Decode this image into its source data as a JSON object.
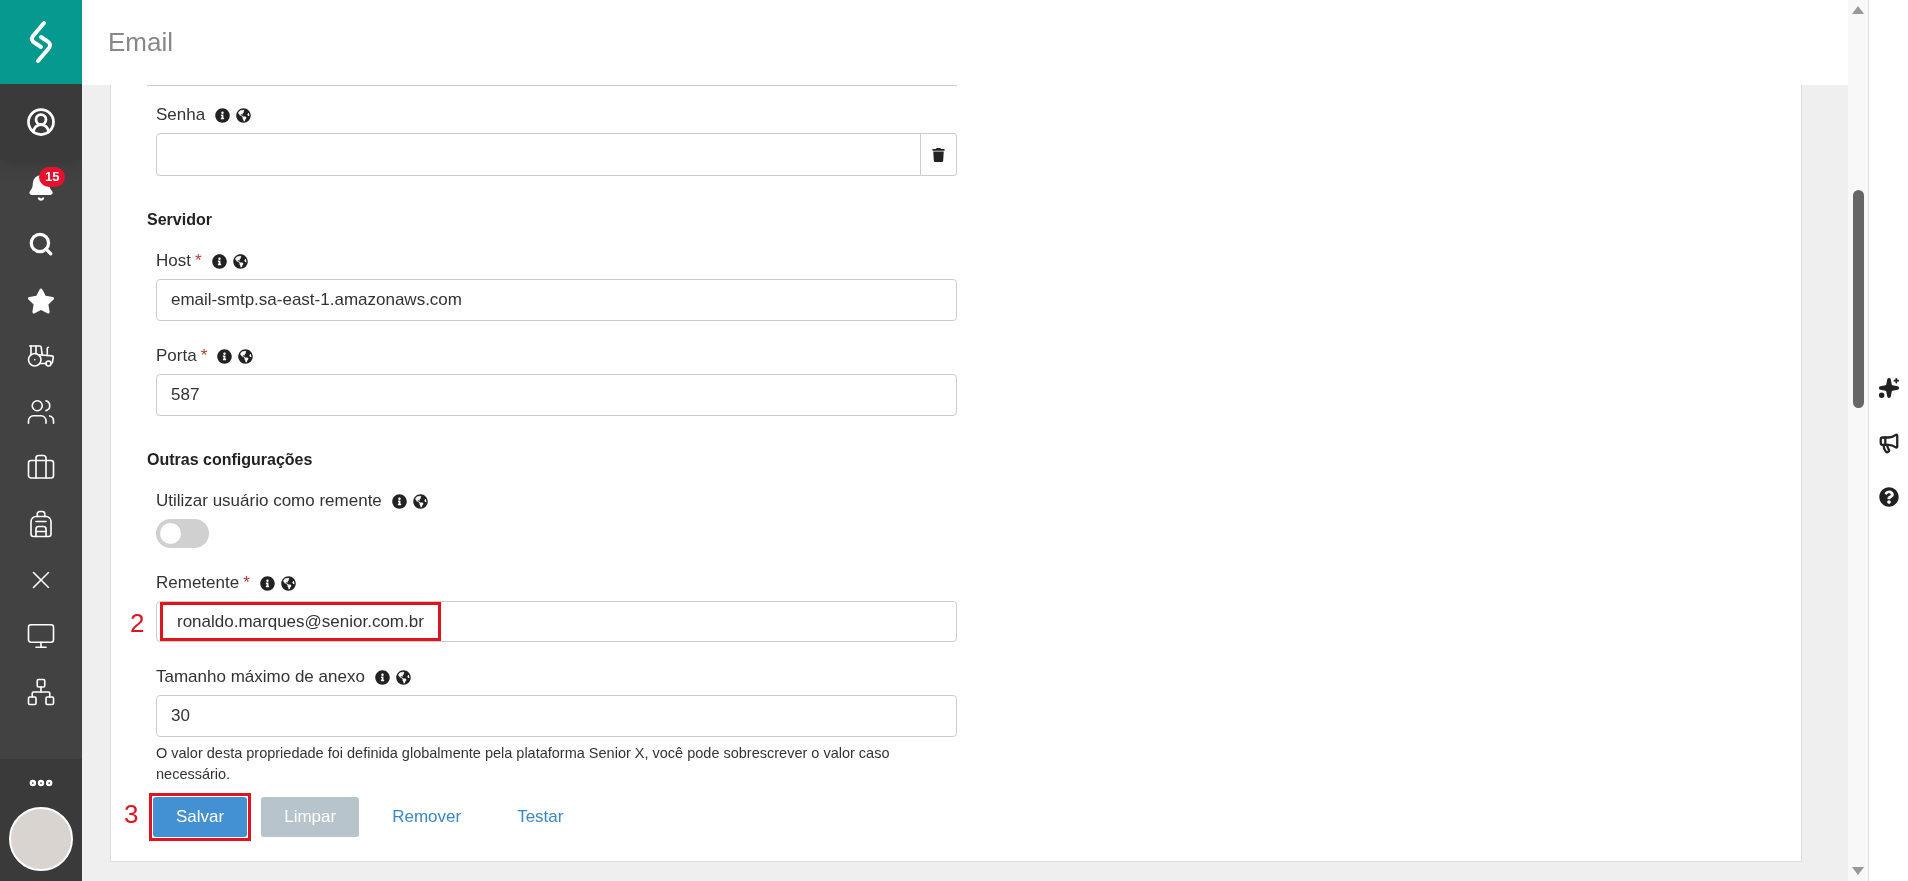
{
  "app_title": "Email",
  "sidebar": {
    "notification_badge": "15"
  },
  "groups": [
    {
      "fields": [
        {
          "label": "Senha",
          "kind": "password"
        }
      ]
    },
    {
      "heading": "Servidor",
      "fields": [
        {
          "label": "Host",
          "required_mark": "*",
          "kind": "text",
          "value": "email-smtp.sa-east-1.amazonaws.com"
        },
        {
          "label": "Porta",
          "required_mark": "*",
          "kind": "text",
          "value": "587"
        }
      ]
    },
    {
      "heading": "Outras configurações",
      "fields": [
        {
          "label": "Utilizar usuário como remente",
          "kind": "toggle",
          "on": false
        },
        {
          "label": "Remetente",
          "required_mark": "*",
          "kind": "text",
          "value": "ronaldo.marques@senior.com.br",
          "annotation": "2"
        },
        {
          "label": "Tamanho máximo de anexo",
          "kind": "text",
          "value": "30",
          "note": "O valor desta propriedade foi definida globalmente pela plataforma Senior X, você pode sobrescrever o valor caso necessário."
        }
      ]
    }
  ],
  "buttons": [
    {
      "label": "Salvar",
      "kind": "primary",
      "disabled": false,
      "annotation": "3"
    },
    {
      "label": "Limpar",
      "kind": "secondary",
      "disabled": true
    },
    {
      "label": "Remover",
      "kind": "link",
      "disabled": false
    },
    {
      "label": "Testar",
      "kind": "link",
      "disabled": false
    }
  ]
}
